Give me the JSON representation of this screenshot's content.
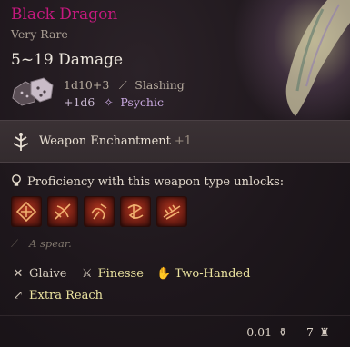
{
  "item": {
    "name": "Black Dragon",
    "rarity": "Very Rare",
    "damage_range": "5~19 Damage",
    "damage_rows": [
      {
        "dice": "1d10+3",
        "type": "Slashing",
        "icon": "slashing-icon"
      },
      {
        "dice": "+1d6",
        "type": "Psychic",
        "icon": "psychic-icon"
      }
    ],
    "enchantment": {
      "label": "Weapon Enchantment",
      "bonus": "+1",
      "icon": "enchantment-icon"
    },
    "proficiency": {
      "label": "Proficiency with this weapon type unlocks:",
      "icon": "bulb-icon"
    },
    "actions": [
      {
        "icon": "action-icon-1"
      },
      {
        "icon": "action-icon-2"
      },
      {
        "icon": "action-icon-3"
      },
      {
        "icon": "action-icon-4"
      },
      {
        "icon": "action-icon-5"
      }
    ],
    "description": "A spear.",
    "properties": [
      {
        "label": "Glaive",
        "icon": "glaive-icon",
        "highlight": false
      },
      {
        "label": "Finesse",
        "icon": "finesse-icon",
        "highlight": true
      },
      {
        "label": "Two-Handed",
        "icon": "two-handed-icon",
        "highlight": false
      }
    ],
    "properties_2": [
      {
        "label": "Extra Reach",
        "icon": "extra-reach-icon",
        "highlight": true
      }
    ],
    "weight": "0.01",
    "value": "7"
  },
  "colors": {
    "name": "#c5197e",
    "psychic": "#c8a8e0",
    "highlight": "#ece4a0",
    "action_tile": "#b3361f"
  }
}
